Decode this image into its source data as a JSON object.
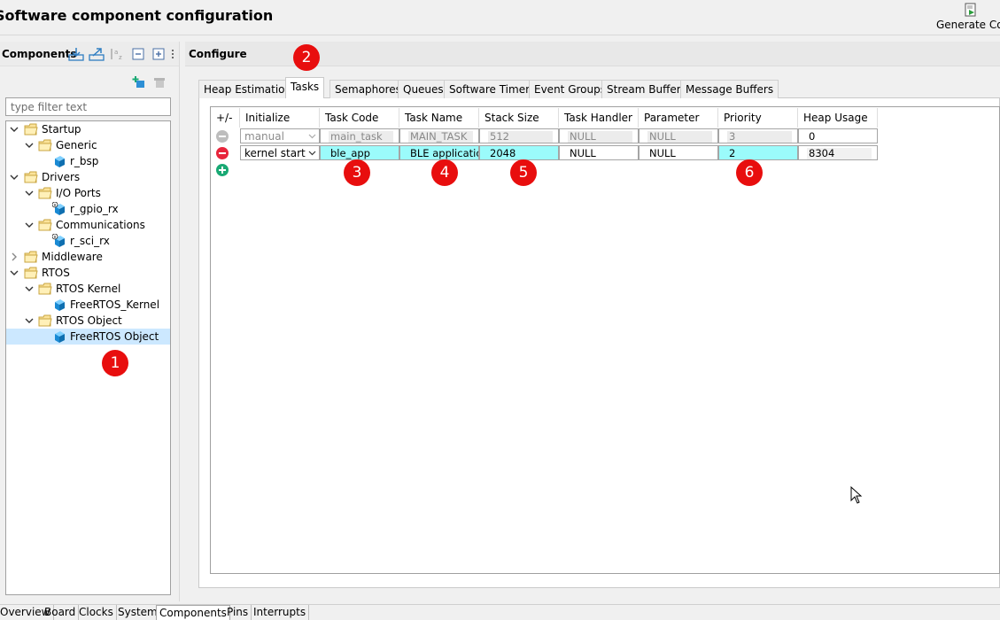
{
  "header": {
    "title": "Software component configuration",
    "generate_label": "Generate Code"
  },
  "components": {
    "title": "Components",
    "filter_placeholder": "type filter text",
    "tree": [
      {
        "label": "Startup",
        "type": "folder",
        "level": 0,
        "expanded": true
      },
      {
        "label": "Generic",
        "type": "folder",
        "level": 1,
        "expanded": true
      },
      {
        "label": "r_bsp",
        "type": "component",
        "level": 2
      },
      {
        "label": "Drivers",
        "type": "folder",
        "level": 0,
        "expanded": true
      },
      {
        "label": "I/O Ports",
        "type": "folder",
        "level": 1,
        "expanded": true
      },
      {
        "label": "r_gpio_rx",
        "type": "component-info",
        "level": 2
      },
      {
        "label": "Communications",
        "type": "folder",
        "level": 1,
        "expanded": true
      },
      {
        "label": "r_sci_rx",
        "type": "component-info",
        "level": 2
      },
      {
        "label": "Middleware",
        "type": "folder",
        "level": 0,
        "expanded": false
      },
      {
        "label": "RTOS",
        "type": "folder",
        "level": 0,
        "expanded": true
      },
      {
        "label": "RTOS Kernel",
        "type": "folder",
        "level": 1,
        "expanded": true
      },
      {
        "label": "FreeRTOS_Kernel",
        "type": "component",
        "level": 2
      },
      {
        "label": "RTOS Object",
        "type": "folder",
        "level": 1,
        "expanded": true
      },
      {
        "label": "FreeRTOS Object",
        "type": "component",
        "level": 2,
        "selected": true
      }
    ]
  },
  "configure": {
    "title": "Configure",
    "tabs": [
      "Heap Estimation",
      "Tasks",
      "Semaphores",
      "Queues",
      "Software Timers",
      "Event Groups",
      "Stream Buffers",
      "Message Buffers"
    ],
    "active_tab": "Tasks",
    "columns": [
      "+/-",
      "Initialize",
      "Task Code",
      "Task Name",
      "Stack Size",
      "Task Handler",
      "Parameter",
      "Priority",
      "Heap Usage"
    ],
    "rows": [
      {
        "initialize": "manual",
        "task_code": "main_task",
        "task_name": "MAIN_TASK",
        "stack_size": "512",
        "task_handler": "NULL",
        "parameter": "NULL",
        "priority": "3",
        "heap_usage": "0",
        "disabled": true
      },
      {
        "initialize": "kernel start",
        "task_code": "ble_app",
        "task_name": "BLE applicatio",
        "stack_size": "2048",
        "task_handler": "NULL",
        "parameter": "NULL",
        "priority": "2",
        "heap_usage": "8304",
        "disabled": false
      }
    ]
  },
  "markers": [
    "1",
    "2",
    "3",
    "4",
    "5",
    "6"
  ],
  "bottom_tabs": [
    "Overview",
    "Board",
    "Clocks",
    "System",
    "Components",
    "Pins",
    "Interrupts"
  ],
  "active_bottom_tab": "Components",
  "colors": {
    "highlight_cell": "#9bfbfb",
    "selection": "#cce8ff",
    "marker": "#e80e0e",
    "remove_button": "#e8253c",
    "add_button": "#19a974"
  }
}
